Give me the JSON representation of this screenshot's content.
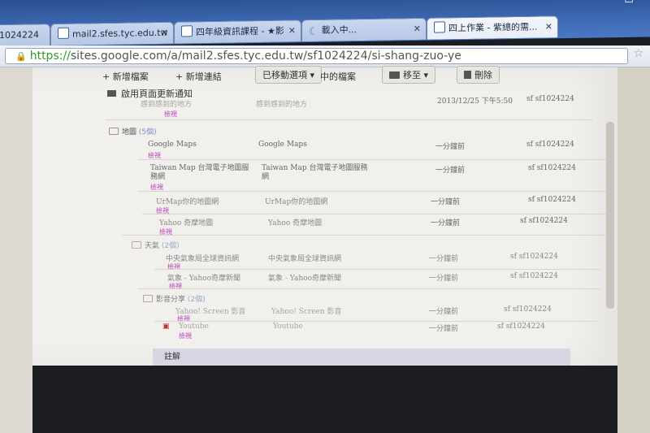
{
  "browser": {
    "tabs": [
      {
        "label": "1024224"
      },
      {
        "label": "mail2.sfes.tyc.edu.tw"
      },
      {
        "label": "四年級資訊課程 - ★影"
      },
      {
        "label": "載入中..."
      },
      {
        "label": "四上作業 - 紫總的需..."
      }
    ],
    "url_scheme": "https://",
    "url_rest": "sites.google.com/a/mail2.sfes.tyc.edu.tw/sf1024224/si-shang-zuo-ye"
  },
  "actions": {
    "new_file": "+ 新增檔案",
    "new_link": "+ 新增連結",
    "moved_items": "已移動選項",
    "files_in": "中的檔案",
    "move_to": "移至",
    "delete": "刪除"
  },
  "notify": "啟用頁面更新通知",
  "top_partial": {
    "col1": "感到感到的地方",
    "col2": "感到感到的地方",
    "date": "2013/12/25 下午5:50",
    "owner": "sf sf1024224",
    "view": "檢視"
  },
  "groups": [
    {
      "name": "地圖",
      "count": "(5個)",
      "rows": [
        {
          "name": "Google Maps",
          "desc": "Google Maps",
          "time": "一分鐘前",
          "owner": "sf sf1024224",
          "view": "檢視"
        },
        {
          "name": "Taiwan Map 台灣電子地圖服務網",
          "desc": "Taiwan Map 台灣電子地圖服務網",
          "time": "一分鐘前",
          "owner": "sf sf1024224",
          "view": "檢視"
        },
        {
          "name": "UrMap你的地圖網",
          "desc": "UrMap你的地圖網",
          "time": "一分鐘前",
          "owner": "sf sf1024224",
          "view": "檢視"
        },
        {
          "name": "Yahoo 奇摩地圖",
          "desc": "Yahoo 奇摩地圖",
          "time": "一分鐘前",
          "owner": "sf sf1024224",
          "view": "檢視"
        }
      ]
    },
    {
      "name": "天氣",
      "count": "(2個)",
      "rows": [
        {
          "name": "中央氣象局全球資訊網",
          "desc": "中央氣象局全球資訊網",
          "time": "一分鐘前",
          "owner": "sf sf1024224",
          "view": "檢視"
        },
        {
          "name": "氣象 - Yahoo奇摩新聞",
          "desc": "氣象 - Yahoo奇摩新聞",
          "time": "一分鐘前",
          "owner": "sf sf1024224",
          "view": "檢視"
        }
      ]
    },
    {
      "name": "影音分享",
      "count": "(2個)",
      "rows": [
        {
          "name": "Yahoo! Screen 影音",
          "desc": "Yahoo! Screen 影音",
          "time": "一分鐘前",
          "owner": "sf sf1024224",
          "view": "檢視"
        },
        {
          "name": "Youtube",
          "desc": "Youtube",
          "time": "一分鐘前",
          "owner": "sf sf1024224",
          "view": "檢視"
        }
      ]
    }
  ],
  "notes_label": "註解"
}
